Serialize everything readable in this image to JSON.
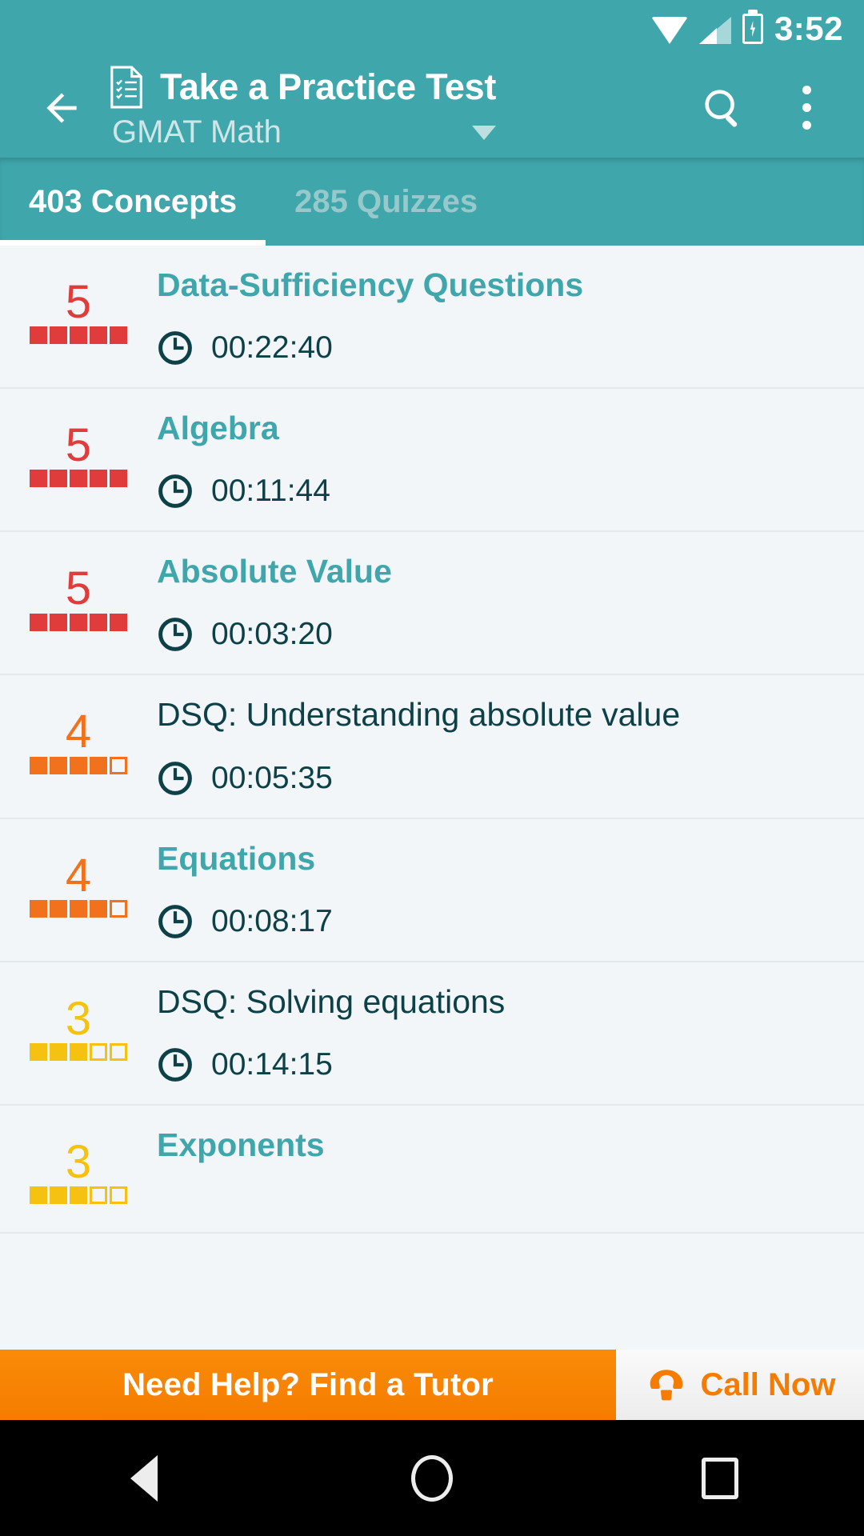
{
  "status_bar": {
    "time": "3:52",
    "icons": [
      "wifi-icon",
      "signal-icon",
      "battery-charging-icon"
    ]
  },
  "app_bar": {
    "back_icon": "back-arrow-icon",
    "doc_icon": "practice-test-document-icon",
    "title": "Take a Practice Test",
    "subtitle": "GMAT Math",
    "subtitle_caret": "chevron-down-icon",
    "search_icon": "search-icon",
    "overflow_icon": "more-vertical-icon"
  },
  "tabs": [
    {
      "label": "403 Concepts",
      "active": true
    },
    {
      "label": "285 Quizzes",
      "active": false
    }
  ],
  "colors": {
    "primary": "#3FA7AC",
    "rating_5": "#E03C3C",
    "rating_4": "#F2711C",
    "rating_3": "#F5C211",
    "link": "#3FA7AC",
    "text_dark": "#0D4047",
    "banner_orange": "#F57C00"
  },
  "list": {
    "rating_max": 5,
    "clock_icon": "clock-icon",
    "rows": [
      {
        "rating": 5,
        "rating_color": "#E03C3C",
        "title": "Data-Sufficiency Questions",
        "title_style": "link",
        "duration": "00:22:40"
      },
      {
        "rating": 5,
        "rating_color": "#E03C3C",
        "title": "Algebra",
        "title_style": "link",
        "duration": "00:11:44"
      },
      {
        "rating": 5,
        "rating_color": "#E03C3C",
        "title": "Absolute Value",
        "title_style": "link",
        "duration": "00:03:20"
      },
      {
        "rating": 4,
        "rating_color": "#F2711C",
        "title": "DSQ: Understanding absolute value",
        "title_style": "plain",
        "duration": "00:05:35"
      },
      {
        "rating": 4,
        "rating_color": "#F2711C",
        "title": "Equations",
        "title_style": "link",
        "duration": "00:08:17"
      },
      {
        "rating": 3,
        "rating_color": "#F5C211",
        "title": "DSQ: Solving equations",
        "title_style": "plain",
        "duration": "00:14:15"
      },
      {
        "rating": 3,
        "rating_color": "#F5C211",
        "title": "Exponents",
        "title_style": "link",
        "duration": ""
      }
    ]
  },
  "banner": {
    "left_text": "Need Help? Find a Tutor",
    "phone_icon": "phone-icon",
    "right_text": "Call Now"
  },
  "nav_bar": {
    "back": "nav-back-icon",
    "home": "nav-home-icon",
    "recents": "nav-recents-icon"
  }
}
